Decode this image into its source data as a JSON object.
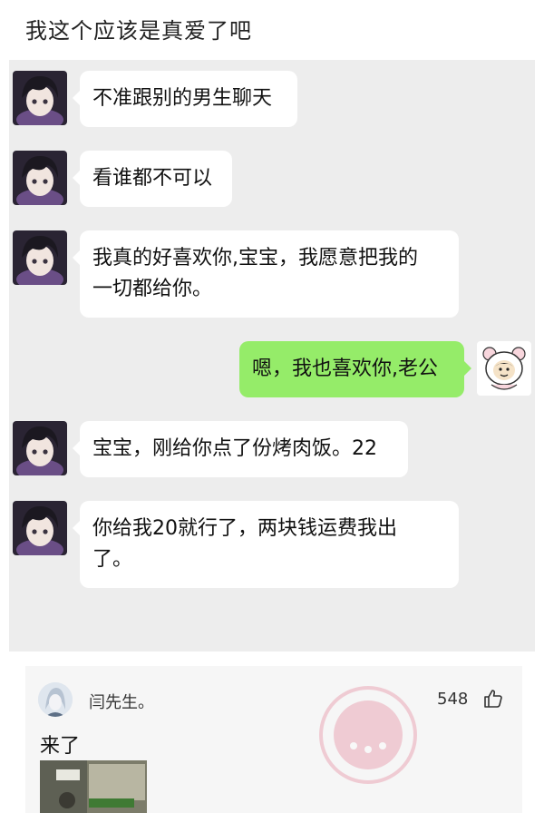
{
  "post": {
    "title": "我这个应该是真爱了吧"
  },
  "chat": {
    "messages": [
      {
        "side": "left",
        "lines": [
          "不准跟别的男生聊天"
        ]
      },
      {
        "side": "left",
        "lines": [
          "看谁都不可以"
        ]
      },
      {
        "side": "left",
        "lines": [
          "我真的好喜欢你,宝宝，我愿意把我的",
          "一切都给你。"
        ]
      },
      {
        "side": "right",
        "lines": [
          "嗯，我也喜欢你,老公"
        ]
      },
      {
        "side": "left",
        "lines": [
          "宝宝，刚给你点了份烤肉饭。22"
        ]
      },
      {
        "side": "left",
        "lines": [
          "你给我20就行了，两块钱运费我出",
          "了。"
        ]
      }
    ]
  },
  "comment": {
    "username": "闫先生。",
    "likes": "548",
    "text": "来了"
  },
  "colors": {
    "chat_background": "#ededed",
    "sent_bubble": "#95ec69",
    "received_bubble": "#ffffff",
    "watermark": "#e0607a"
  }
}
